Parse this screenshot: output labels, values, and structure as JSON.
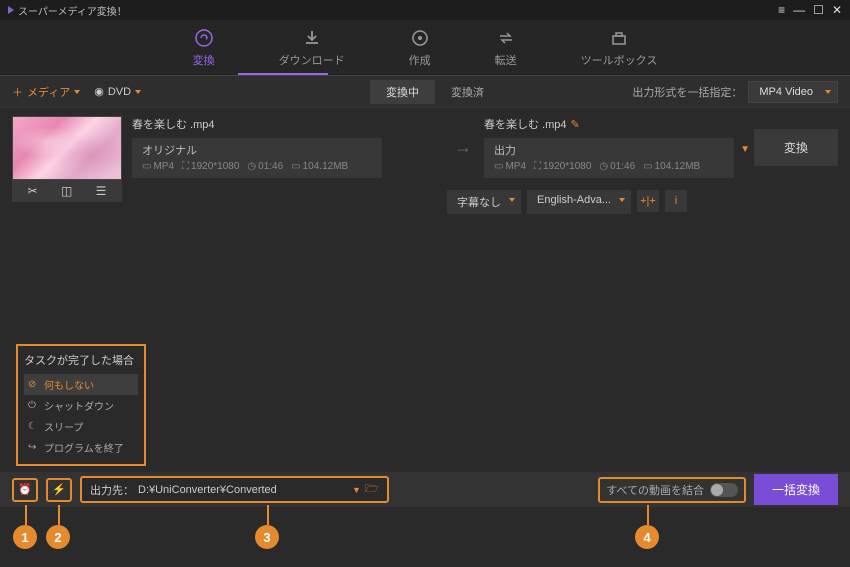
{
  "app": {
    "title": "スーパーメディア変換！"
  },
  "nav": {
    "convert": "変換",
    "download": "ダウンロード",
    "create": "作成",
    "transfer": "転送",
    "toolbox": "ツールボックス"
  },
  "toolbar": {
    "add_media": "メディア",
    "dvd": "DVD",
    "subtab_converting": "変換中",
    "subtab_done": "変換済",
    "out_label": "出力形式を一括指定：",
    "out_format": "MP4 Video"
  },
  "file": {
    "src_name": "春を楽しむ .mp4",
    "src_label": "オリジナル",
    "out_name": "春を楽しむ .mp4",
    "out_label": "出力",
    "fmt": "MP4",
    "res": "1920*1080",
    "dur": "01:46",
    "size": "104.12MB",
    "convert_btn": "変換",
    "subtitle": "字幕なし",
    "audio": "English-Adva..."
  },
  "task_menu": {
    "title": "タスクが完了した場合",
    "none": "何もしない",
    "shutdown": "シャットダウン",
    "sleep": "スリープ",
    "exit": "プログラムを終了"
  },
  "footer": {
    "out_label": "出力先：",
    "out_path": "D:¥UniConverter¥Converted",
    "merge_label": "すべての動画を結合",
    "batch_btn": "一括変換"
  },
  "anno": {
    "a1": "1",
    "a2": "2",
    "a3": "3",
    "a4": "4"
  },
  "colors": {
    "accent": "#e58a2e",
    "primary": "#9866e8"
  }
}
